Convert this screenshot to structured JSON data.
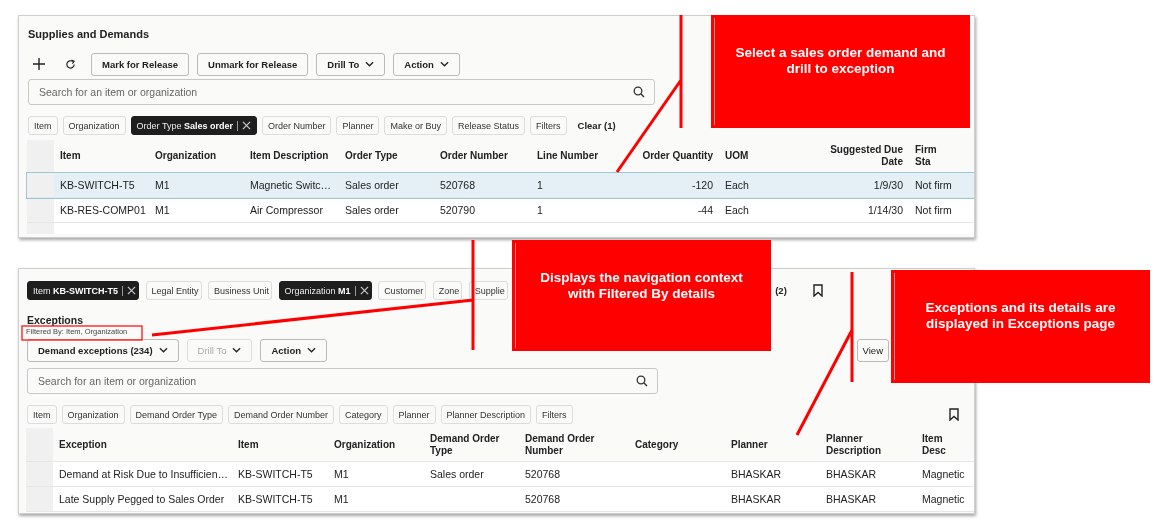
{
  "supplies_and_demands": {
    "title": "Supplies and Demands",
    "toolbar": [
      {
        "kind": "add"
      },
      {
        "kind": "refresh"
      },
      {
        "kind": "button",
        "label": "Mark for Release"
      },
      {
        "kind": "button",
        "label": "Unmark for Release"
      },
      {
        "kind": "menu",
        "label": "Drill To",
        "disabled": false
      },
      {
        "kind": "menu",
        "label": "Action",
        "disabled": false
      }
    ],
    "search": {
      "placeholder": "Search for an item or organization"
    },
    "filters": [
      {
        "label": "Item",
        "applied": false
      },
      {
        "label": "Organization",
        "applied": false
      },
      {
        "label": "Order Type",
        "value": "Sales order",
        "applied": true
      },
      {
        "label": "Order Number",
        "applied": false
      },
      {
        "label": "Planner",
        "applied": false
      },
      {
        "label": "Make or Buy",
        "applied": false
      },
      {
        "label": "Release Status",
        "applied": false
      },
      {
        "label": "Filters",
        "applied": false
      }
    ],
    "clear": "Clear (1)",
    "table": {
      "columns": [
        {
          "label": "Item"
        },
        {
          "label": "Organization"
        },
        {
          "label": "Item Description"
        },
        {
          "label": "Order Type"
        },
        {
          "label": "Order Number"
        },
        {
          "label": "Line Number"
        },
        {
          "label": "Order Quantity",
          "kind": "number"
        },
        {
          "label": "UOM"
        },
        {
          "label": "Suggested Due Date",
          "kind": "number"
        },
        {
          "label": "Firm Sta"
        }
      ],
      "rows": [
        {
          "selected": true,
          "cells": [
            "KB-SWITCH-T5",
            "M1",
            "Magnetic Switc…",
            "Sales order",
            "520768",
            "1",
            "-120",
            "Each",
            "1/9/30",
            "Not firm"
          ]
        },
        {
          "selected": false,
          "cells": [
            "KB-RES-COMP01",
            "M1",
            "Air Compressor",
            "Sales order",
            "520790",
            "1",
            "-44",
            "Each",
            "1/14/30",
            "Not firm"
          ]
        }
      ]
    }
  },
  "exceptions_page": {
    "context_filters": [
      {
        "label": "Item",
        "value": "KB-SWITCH-T5",
        "applied": true
      },
      {
        "label": "Legal Entity",
        "applied": false
      },
      {
        "label": "Business Unit",
        "applied": false
      },
      {
        "label": "Organization",
        "value": "M1",
        "applied": true
      },
      {
        "label": "Customer",
        "applied": false
      },
      {
        "label": "Zone",
        "applied": false
      },
      {
        "label": "Supplie",
        "applied": false
      }
    ],
    "clear": "(2)",
    "title": "Exceptions",
    "filtered_by": "Filtered By: Item, Organization",
    "toolbar": [
      {
        "kind": "menu",
        "label": "Demand exceptions (234)",
        "disabled": false
      },
      {
        "kind": "menu",
        "label": "Drill To",
        "disabled": true
      },
      {
        "kind": "menu",
        "label": "Action",
        "disabled": false
      }
    ],
    "view_button": "View",
    "search": {
      "placeholder": "Search for an item or organization"
    },
    "filters": [
      {
        "label": "Item",
        "applied": false
      },
      {
        "label": "Organization",
        "applied": false
      },
      {
        "label": "Demand Order Type",
        "applied": false
      },
      {
        "label": "Demand Order Number",
        "applied": false
      },
      {
        "label": "Category",
        "applied": false
      },
      {
        "label": "Planner",
        "applied": false
      },
      {
        "label": "Planner Description",
        "applied": false
      },
      {
        "label": "Filters",
        "applied": false
      }
    ],
    "table": {
      "columns": [
        {
          "label": "Exception"
        },
        {
          "label": "Item"
        },
        {
          "label": "Organization"
        },
        {
          "label": "Demand Order Type"
        },
        {
          "label": "Demand Order Number"
        },
        {
          "label": "Category"
        },
        {
          "label": "Planner"
        },
        {
          "label": "Planner Description"
        },
        {
          "label": "Item Desc"
        }
      ],
      "rows": [
        {
          "selected": false,
          "cells": [
            "Demand at Risk Due to Insufficien…",
            "KB-SWITCH-T5",
            "M1",
            "Sales order",
            "520768",
            null,
            "BHASKAR",
            "BHASKAR",
            "Magnetic"
          ]
        },
        {
          "selected": false,
          "cells": [
            "Late Supply Pegged to Sales Order",
            "KB-SWITCH-T5",
            "M1",
            null,
            "520768",
            null,
            "BHASKAR",
            "BHASKAR",
            "Magnetic"
          ]
        }
      ]
    }
  },
  "callouts": [
    {
      "text": "Select a sales order demand and drill to exception"
    },
    {
      "text": "Displays the navigation context with Filtered By details"
    },
    {
      "text": "Exceptions and its details are displayed in Exceptions page"
    }
  ]
}
